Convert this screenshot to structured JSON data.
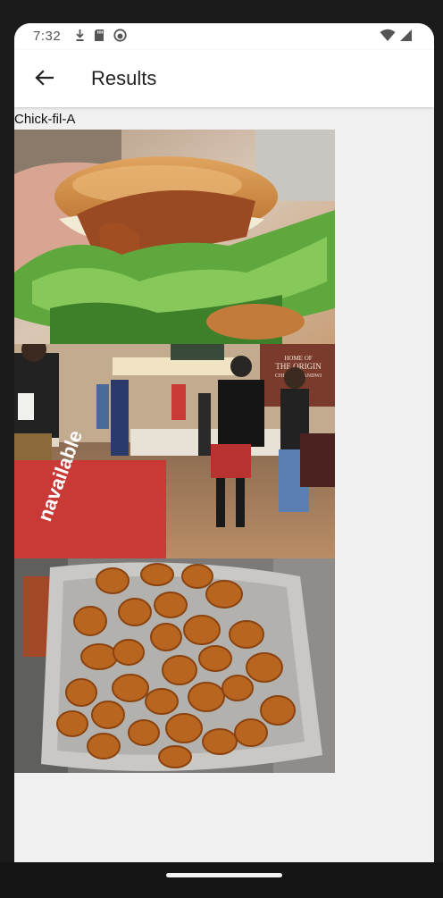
{
  "status_bar": {
    "time": "7:32",
    "left_icons": [
      "download-icon",
      "sd-card-icon",
      "sync-icon"
    ],
    "right_icons": [
      "wifi-icon",
      "signal-icon"
    ]
  },
  "app_bar": {
    "title": "Results",
    "back_icon": "arrow-left-icon"
  },
  "results": {
    "name": "Chick-fil-A",
    "photos": [
      {
        "subject": "chicken sandwich"
      },
      {
        "subject": "restaurant interior",
        "sign_line1": "HOME OF",
        "sign_line2": "THE ORIGIN",
        "sign_line3": "CHICKEN SANDWI",
        "banner_text": "navailable"
      },
      {
        "subject": "chicken nuggets tray"
      }
    ]
  },
  "colors": {
    "screen_bg": "#f0f0f0",
    "app_bar_bg": "#ffffff",
    "title_text": "#222222",
    "frame": "#1b1b1b"
  }
}
